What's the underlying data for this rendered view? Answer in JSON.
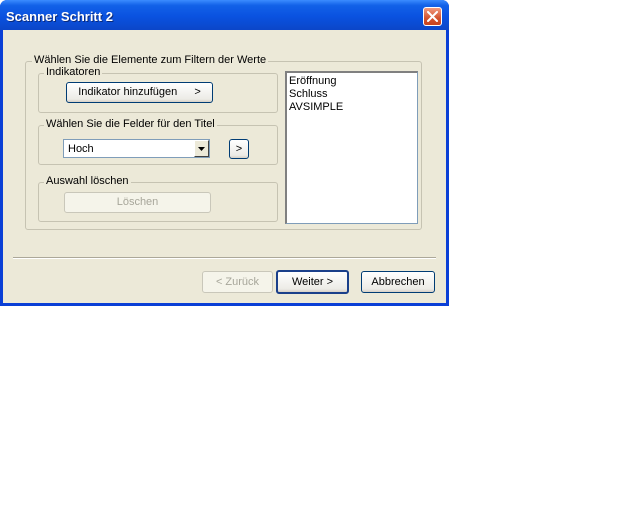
{
  "window": {
    "title": "Scanner Schritt 2",
    "close_icon": "close-icon"
  },
  "filter_group": {
    "label": "Wählen Sie die Elemente zum Filtern der Werte"
  },
  "indicators": {
    "label": "Indikatoren",
    "add_button": "Indikator hinzufügen",
    "add_button_arrow": ">"
  },
  "title_fields": {
    "label": "Wählen Sie die Felder für den Titel",
    "selected": "Hoch",
    "add_arrow": ">"
  },
  "clear_selection": {
    "label": "Auswahl löschen",
    "delete_button": "Löschen"
  },
  "elements_list": {
    "items": [
      "Eröffnung",
      "Schluss",
      "AVSIMPLE"
    ]
  },
  "footer": {
    "back_button": "< Zurück",
    "next_button": "Weiter >",
    "cancel_button": "Abbrechen"
  }
}
